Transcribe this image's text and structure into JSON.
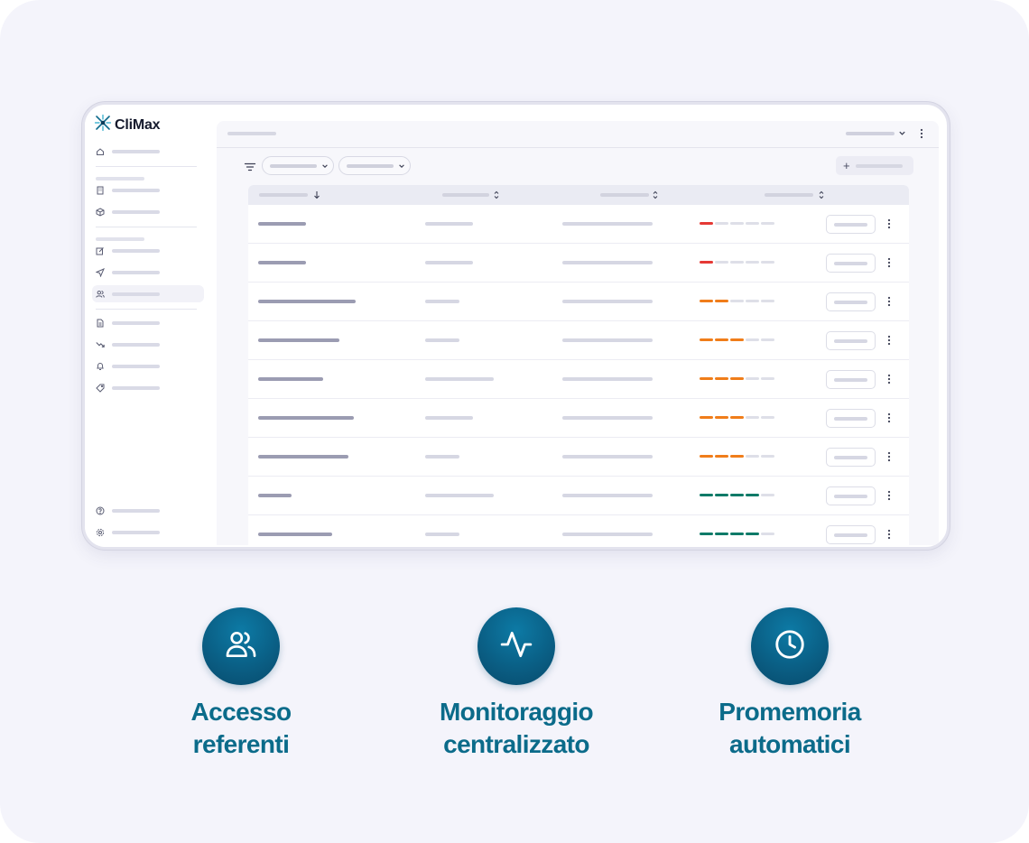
{
  "app": {
    "brand_name": "CliMax",
    "brand_icon": "climax-logo-icon"
  },
  "sidebar": {
    "icons": [
      "home-icon",
      "building-icon",
      "package-icon",
      "edit-icon",
      "send-icon",
      "users-icon",
      "document-icon",
      "trending-down-icon",
      "bell-icon",
      "tag-icon",
      "help-icon",
      "settings-icon"
    ],
    "active_item": "users-icon"
  },
  "table": {
    "rows": [
      {
        "level": 1,
        "status_color": "#e53935"
      },
      {
        "level": 1,
        "status_color": "#e53935"
      },
      {
        "level": 2,
        "status_color": "#f07d1a"
      },
      {
        "level": 3,
        "status_color": "#f07d1a"
      },
      {
        "level": 3,
        "status_color": "#f07d1a"
      },
      {
        "level": 3,
        "status_color": "#f07d1a"
      },
      {
        "level": 3,
        "status_color": "#f07d1a"
      },
      {
        "level": 4,
        "status_color": "#0f7a68"
      },
      {
        "level": 4,
        "status_color": "#0f7a68"
      }
    ],
    "meter_max": 5
  },
  "features": [
    {
      "icon": "users-icon",
      "line1": "Accesso",
      "line2": "referenti"
    },
    {
      "icon": "activity-icon",
      "line1": "Monitoraggio",
      "line2": "centralizzato"
    },
    {
      "icon": "clock-icon",
      "line1": "Promemoria",
      "line2": "automatici"
    }
  ],
  "colors": {
    "accent": "#0b6b8a",
    "background": "#f4f4fb",
    "danger": "#e53935",
    "warning": "#f07d1a",
    "success": "#0f7a68"
  }
}
